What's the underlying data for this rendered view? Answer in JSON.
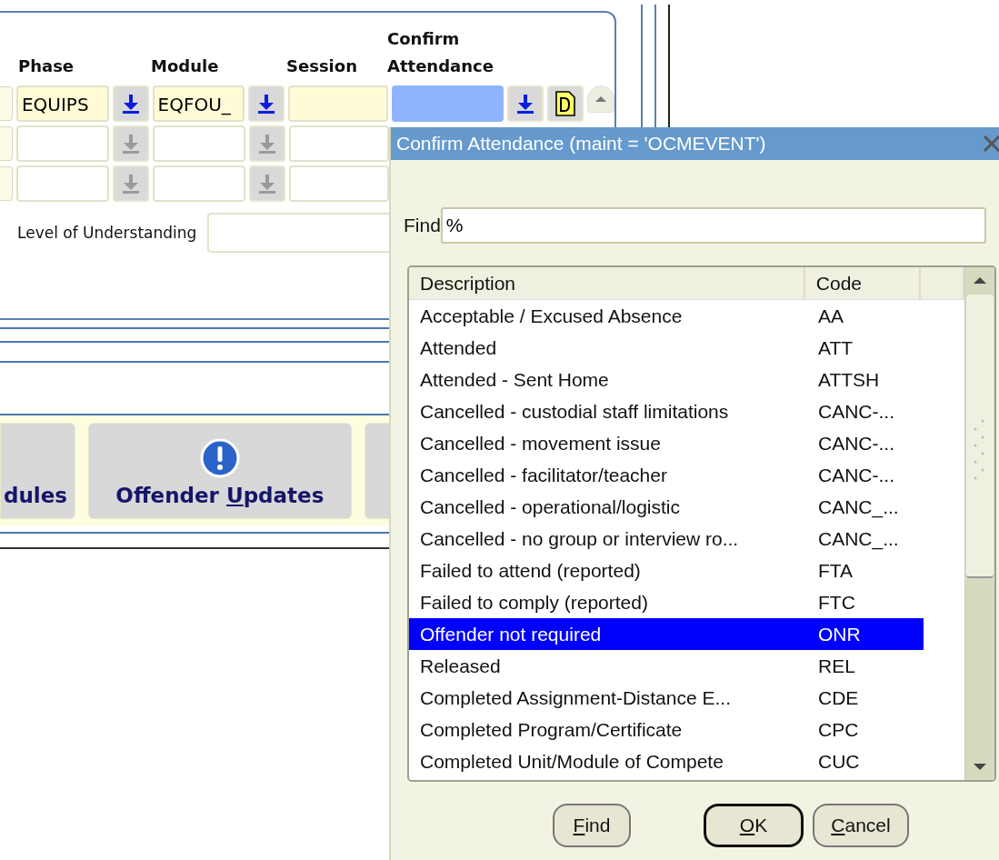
{
  "form": {
    "columns": [
      {
        "label": "Phase"
      },
      {
        "label": "Module"
      },
      {
        "label": "Session"
      },
      {
        "label": "Confirm Attendance"
      }
    ],
    "rows": [
      {
        "phase": "EQUIPS",
        "module": "EQFOU_",
        "current": true,
        "lov_enabled": true
      },
      {
        "current": false,
        "lov_enabled": false
      },
      {
        "current": false,
        "lov_enabled": false
      }
    ],
    "understanding_label": "Level of Understanding"
  },
  "toolbar_buttons": [
    {
      "before": "dules"
    },
    {
      "before": "Offender ",
      "key": "U",
      "after": "pdates",
      "kind": "alert"
    }
  ],
  "dialog": {
    "title": "Confirm Attendance (maint = 'OCMEVENT')",
    "find_label": "Find",
    "find_value": "%",
    "columns": [
      "Description",
      "Code"
    ],
    "rows": [
      {
        "description": "Acceptable / Excused Absence",
        "code": "AA",
        "selected": false
      },
      {
        "description": "Attended",
        "code": "ATT",
        "selected": false
      },
      {
        "description": "Attended - Sent Home",
        "code": "ATTSH",
        "selected": false
      },
      {
        "description": "Cancelled - custodial staff limitations",
        "code": "CANC-...",
        "selected": false
      },
      {
        "description": "Cancelled - movement issue",
        "code": "CANC-...",
        "selected": false
      },
      {
        "description": "Cancelled - facilitator/teacher",
        "code": "CANC-...",
        "selected": false
      },
      {
        "description": "Cancelled - operational/logistic",
        "code": "CANC_...",
        "selected": false
      },
      {
        "description": "Cancelled - no group or interview ro...",
        "code": "CANC_...",
        "selected": false
      },
      {
        "description": "Failed to attend (reported)",
        "code": "FTA",
        "selected": false
      },
      {
        "description": "Failed to comply (reported)",
        "code": "FTC",
        "selected": false
      },
      {
        "description": "Offender not required",
        "code": "ONR",
        "selected": true
      },
      {
        "description": "Released",
        "code": "REL",
        "selected": false
      },
      {
        "description": "Completed Assignment-Distance E...",
        "code": "CDE",
        "selected": false
      },
      {
        "description": "Completed Program/Certificate",
        "code": "CPC",
        "selected": false
      },
      {
        "description": "Completed Unit/Module of Compete",
        "code": "CUC",
        "selected": false
      }
    ],
    "buttons": [
      {
        "key": "F",
        "after": "ind",
        "default": false
      },
      {
        "key": "O",
        "after": "K",
        "default": true
      },
      {
        "key": "C",
        "after": "ancel",
        "default": false
      }
    ]
  }
}
